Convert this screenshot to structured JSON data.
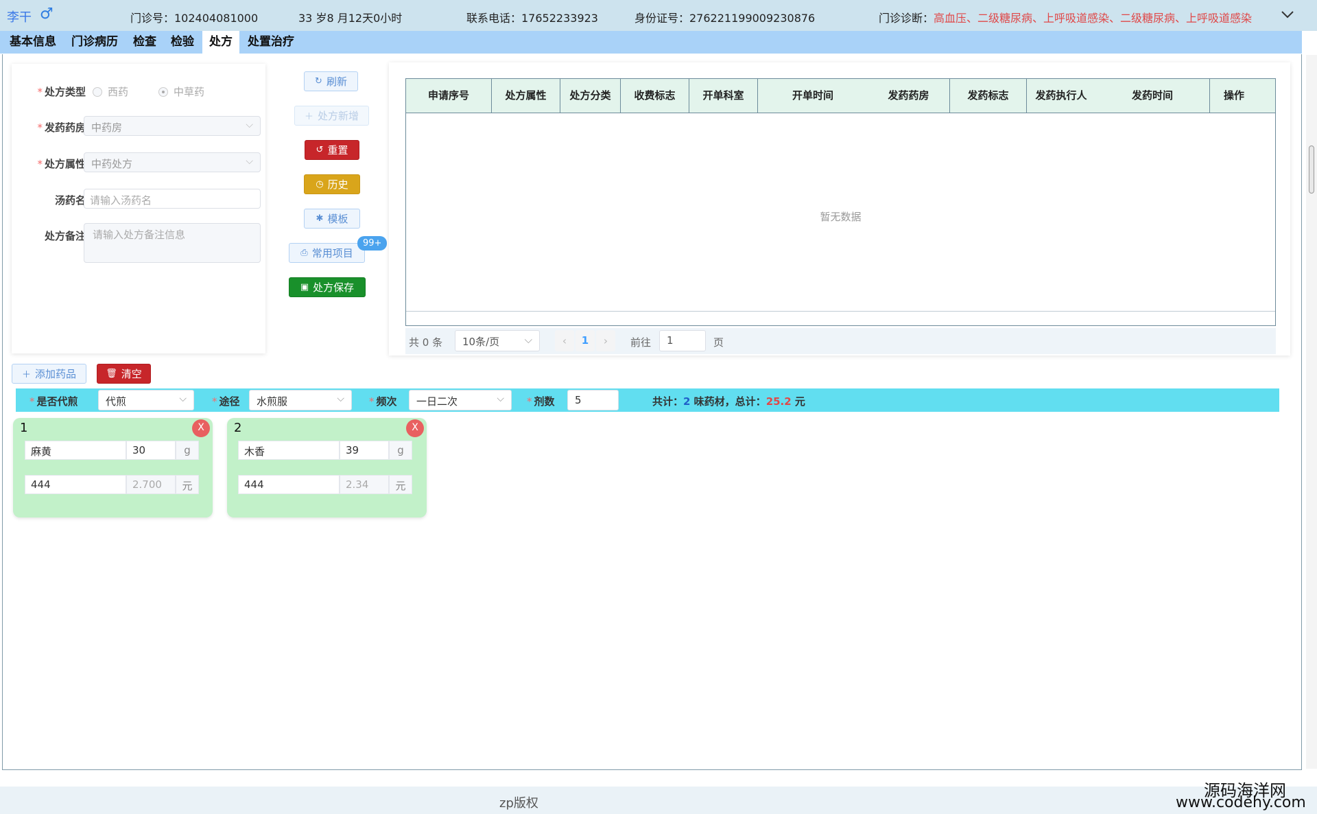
{
  "patient": {
    "name": "李干",
    "gender_symbol": "♂",
    "clinic_no": "门诊号：102404081000",
    "age": "33 岁8 月12天0小时",
    "phone": "联系电话：17652233923",
    "id_card": "身份证号：276221199009230876",
    "diagnosis_label": "门诊诊断：",
    "diagnosis": "高血压、二级糖尿病、上呼吸道感染、二级糖尿病、上呼吸道感染"
  },
  "tabs": [
    {
      "label": "基本信息"
    },
    {
      "label": "门诊病历"
    },
    {
      "label": "检查"
    },
    {
      "label": "检验"
    },
    {
      "label": "处方",
      "active": true
    },
    {
      "label": "处置治疗"
    }
  ],
  "form": {
    "type_label": "处方类型",
    "type_options": [
      "西药",
      "中草药"
    ],
    "type_selected": "中草药",
    "pharmacy_label": "发药药房",
    "pharmacy_value": "中药房",
    "attr_label": "处方属性",
    "attr_value": "中药处方",
    "decoction_label": "汤药名",
    "decoction_placeholder": "请输入汤药名",
    "remark_label": "处方备注",
    "remark_placeholder": "请输入处方备注信息"
  },
  "actions": {
    "refresh": "刷新",
    "add": "处方新增",
    "reset": "重置",
    "history": "历史",
    "template": "模板",
    "common": "常用项目",
    "common_badge": "99+",
    "save": "处方保存"
  },
  "table": {
    "columns": [
      "申请序号",
      "处方属性",
      "处方分类",
      "收费标志",
      "开单科室",
      "开单时间",
      "发药药房",
      "发药标志",
      "发药执行人",
      "发药时间",
      "操作"
    ],
    "rows": [],
    "empty_text": "暂无数据"
  },
  "pagination": {
    "total": "共 0 条",
    "page_size": "10条/页",
    "current": "1",
    "goto_label": "前往",
    "goto_value": "1",
    "page_unit": "页"
  },
  "herbs_toolbar": {
    "add": "添加药品",
    "clear": "清空"
  },
  "options": {
    "decoct_label": "是否代煎",
    "decoct_value": "代煎",
    "route_label": "途径",
    "route_value": "水煎服",
    "freq_label": "频次",
    "freq_value": "一日二次",
    "doses_label": "剂数",
    "doses_value": "5",
    "sum_prefix": "共计：",
    "sum_count": "2",
    "sum_mid": " 味药材，总计：",
    "sum_total": "25.2",
    "sum_unit": " 元"
  },
  "herbs": [
    {
      "index": "1",
      "name": "麻黄",
      "qty": "30",
      "unit": "g",
      "code": "444",
      "price": "2.700",
      "price_unit": "元",
      "close": "X"
    },
    {
      "index": "2",
      "name": "木香",
      "qty": "39",
      "unit": "g",
      "code": "444",
      "price": "2.34",
      "price_unit": "元",
      "close": "X"
    }
  ],
  "footer": {
    "copyright": "zp版权",
    "watermark_cn": "源码海洋网",
    "watermark_url": "www.codehy.com"
  }
}
